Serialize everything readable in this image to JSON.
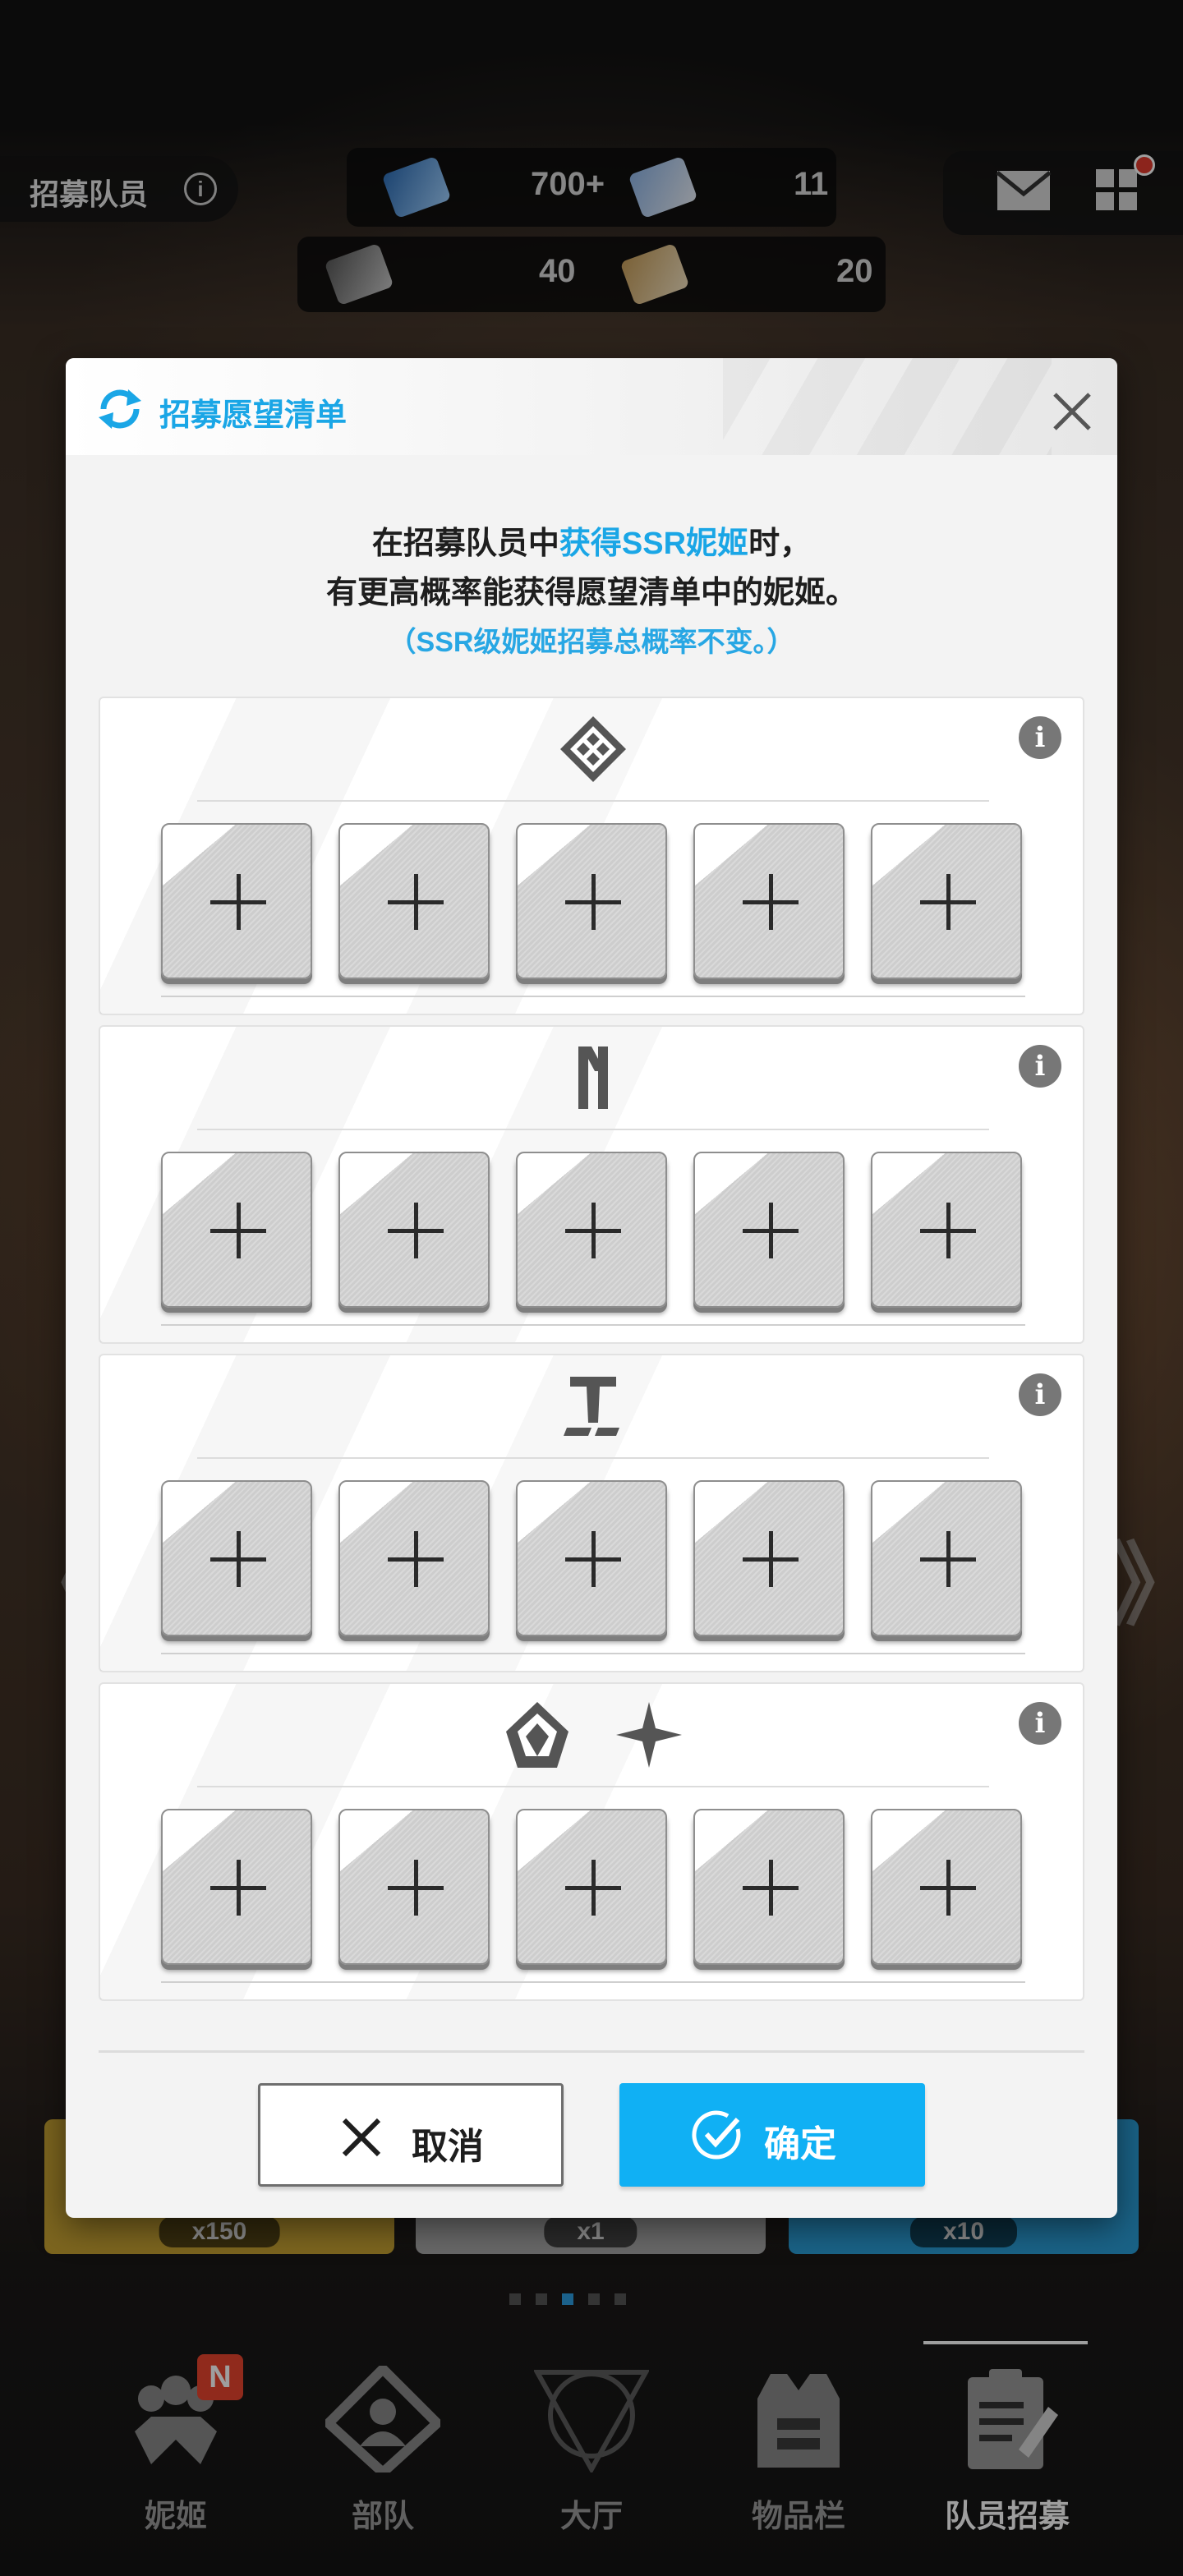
{
  "background": {
    "top_left_title": "招募队员",
    "currencies": [
      {
        "value": "700+",
        "icon": "ticket-icon"
      },
      {
        "value": "11",
        "icon": "recruit-voucher-icon"
      },
      {
        "value": "40",
        "icon": "ticket-icon"
      },
      {
        "value": "20",
        "icon": "recruit-voucher-icon"
      }
    ],
    "bottom_cards": [
      {
        "label": "x150",
        "color": "#c8a332"
      },
      {
        "label": "x1",
        "color": "#a8a8a8"
      },
      {
        "label": "x10",
        "color": "#2a9fd8"
      }
    ],
    "bottom_nav": [
      {
        "label": "妮姬",
        "icon": "nikke-icon",
        "badge": "N"
      },
      {
        "label": "部队",
        "icon": "squad-icon"
      },
      {
        "label": "大厅",
        "icon": "lobby-icon"
      },
      {
        "label": "物品栏",
        "icon": "inventory-icon"
      },
      {
        "label": "队员招募",
        "icon": "recruit-icon",
        "active": true
      }
    ]
  },
  "modal": {
    "title": "招募愿望清单",
    "description": {
      "line1_before": "在招募队员中",
      "line1_highlight": "获得SSR妮姬",
      "line1_after": "时，",
      "line2": "有更高概率能获得愿望清单中的妮姬。",
      "line3": "（SSR级妮姬招募总概率不变。）"
    },
    "sections": [
      {
        "icon": "elysion-icon",
        "slots": 5
      },
      {
        "icon": "missilis-icon",
        "slots": 5
      },
      {
        "icon": "tetra-icon",
        "slots": 5
      },
      {
        "icon": "pilgrim-abnormal-icon",
        "slots": 5
      }
    ],
    "cancel_label": "取消",
    "confirm_label": "确定",
    "accent_color": "#1aa6e6"
  }
}
